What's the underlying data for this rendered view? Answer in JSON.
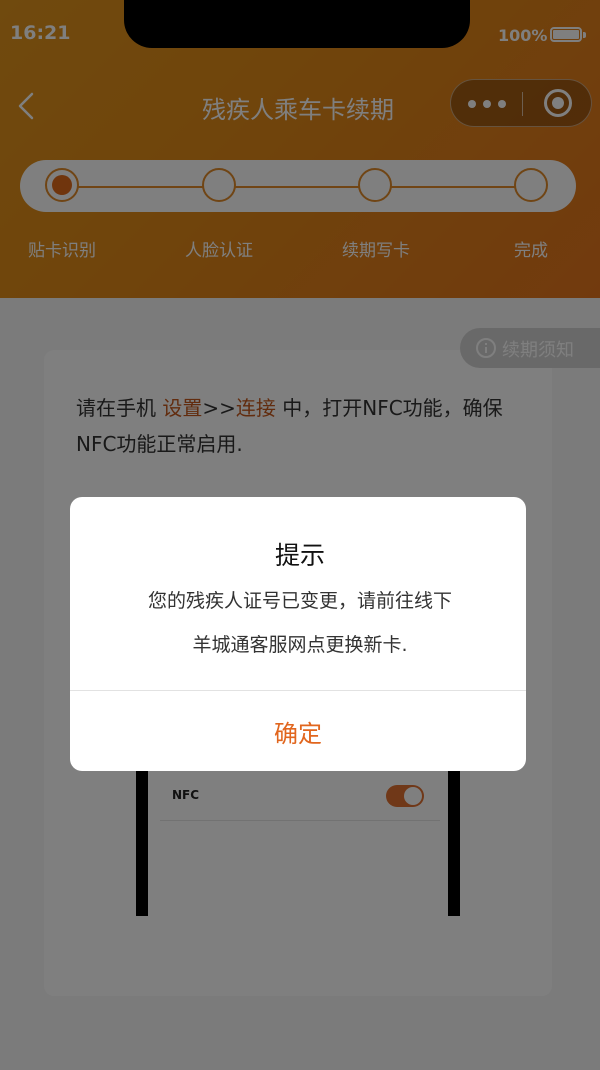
{
  "status_bar": {
    "time": "16:21",
    "battery": "100%"
  },
  "nav": {
    "title": "残疾人乘车卡续期"
  },
  "steps": [
    {
      "label": "贴卡识别",
      "active": true
    },
    {
      "label": "人脸认证",
      "active": false
    },
    {
      "label": "续期写卡",
      "active": false
    },
    {
      "label": "完成",
      "active": false
    }
  ],
  "notice": {
    "label": "续期须知",
    "icon": "info-icon"
  },
  "instructions": {
    "prefix": "请在手机 ",
    "link1": "设置",
    "sep": ">>",
    "link2": "连接",
    "suffix": " 中，打开NFC功能，确保NFC功能正常启用."
  },
  "nfc": {
    "label": "NFC",
    "enabled": true
  },
  "dialog": {
    "title": "提示",
    "message_line1": "您的残疾人证号已变更，请前往线下",
    "message_line2": "羊城通客服网点更换新卡.",
    "ok_label": "确定"
  },
  "colors": {
    "header_gradient_start": "#e0941c",
    "header_gradient_end": "#e4751c",
    "accent": "#e1661e",
    "link": "#c5581c"
  }
}
